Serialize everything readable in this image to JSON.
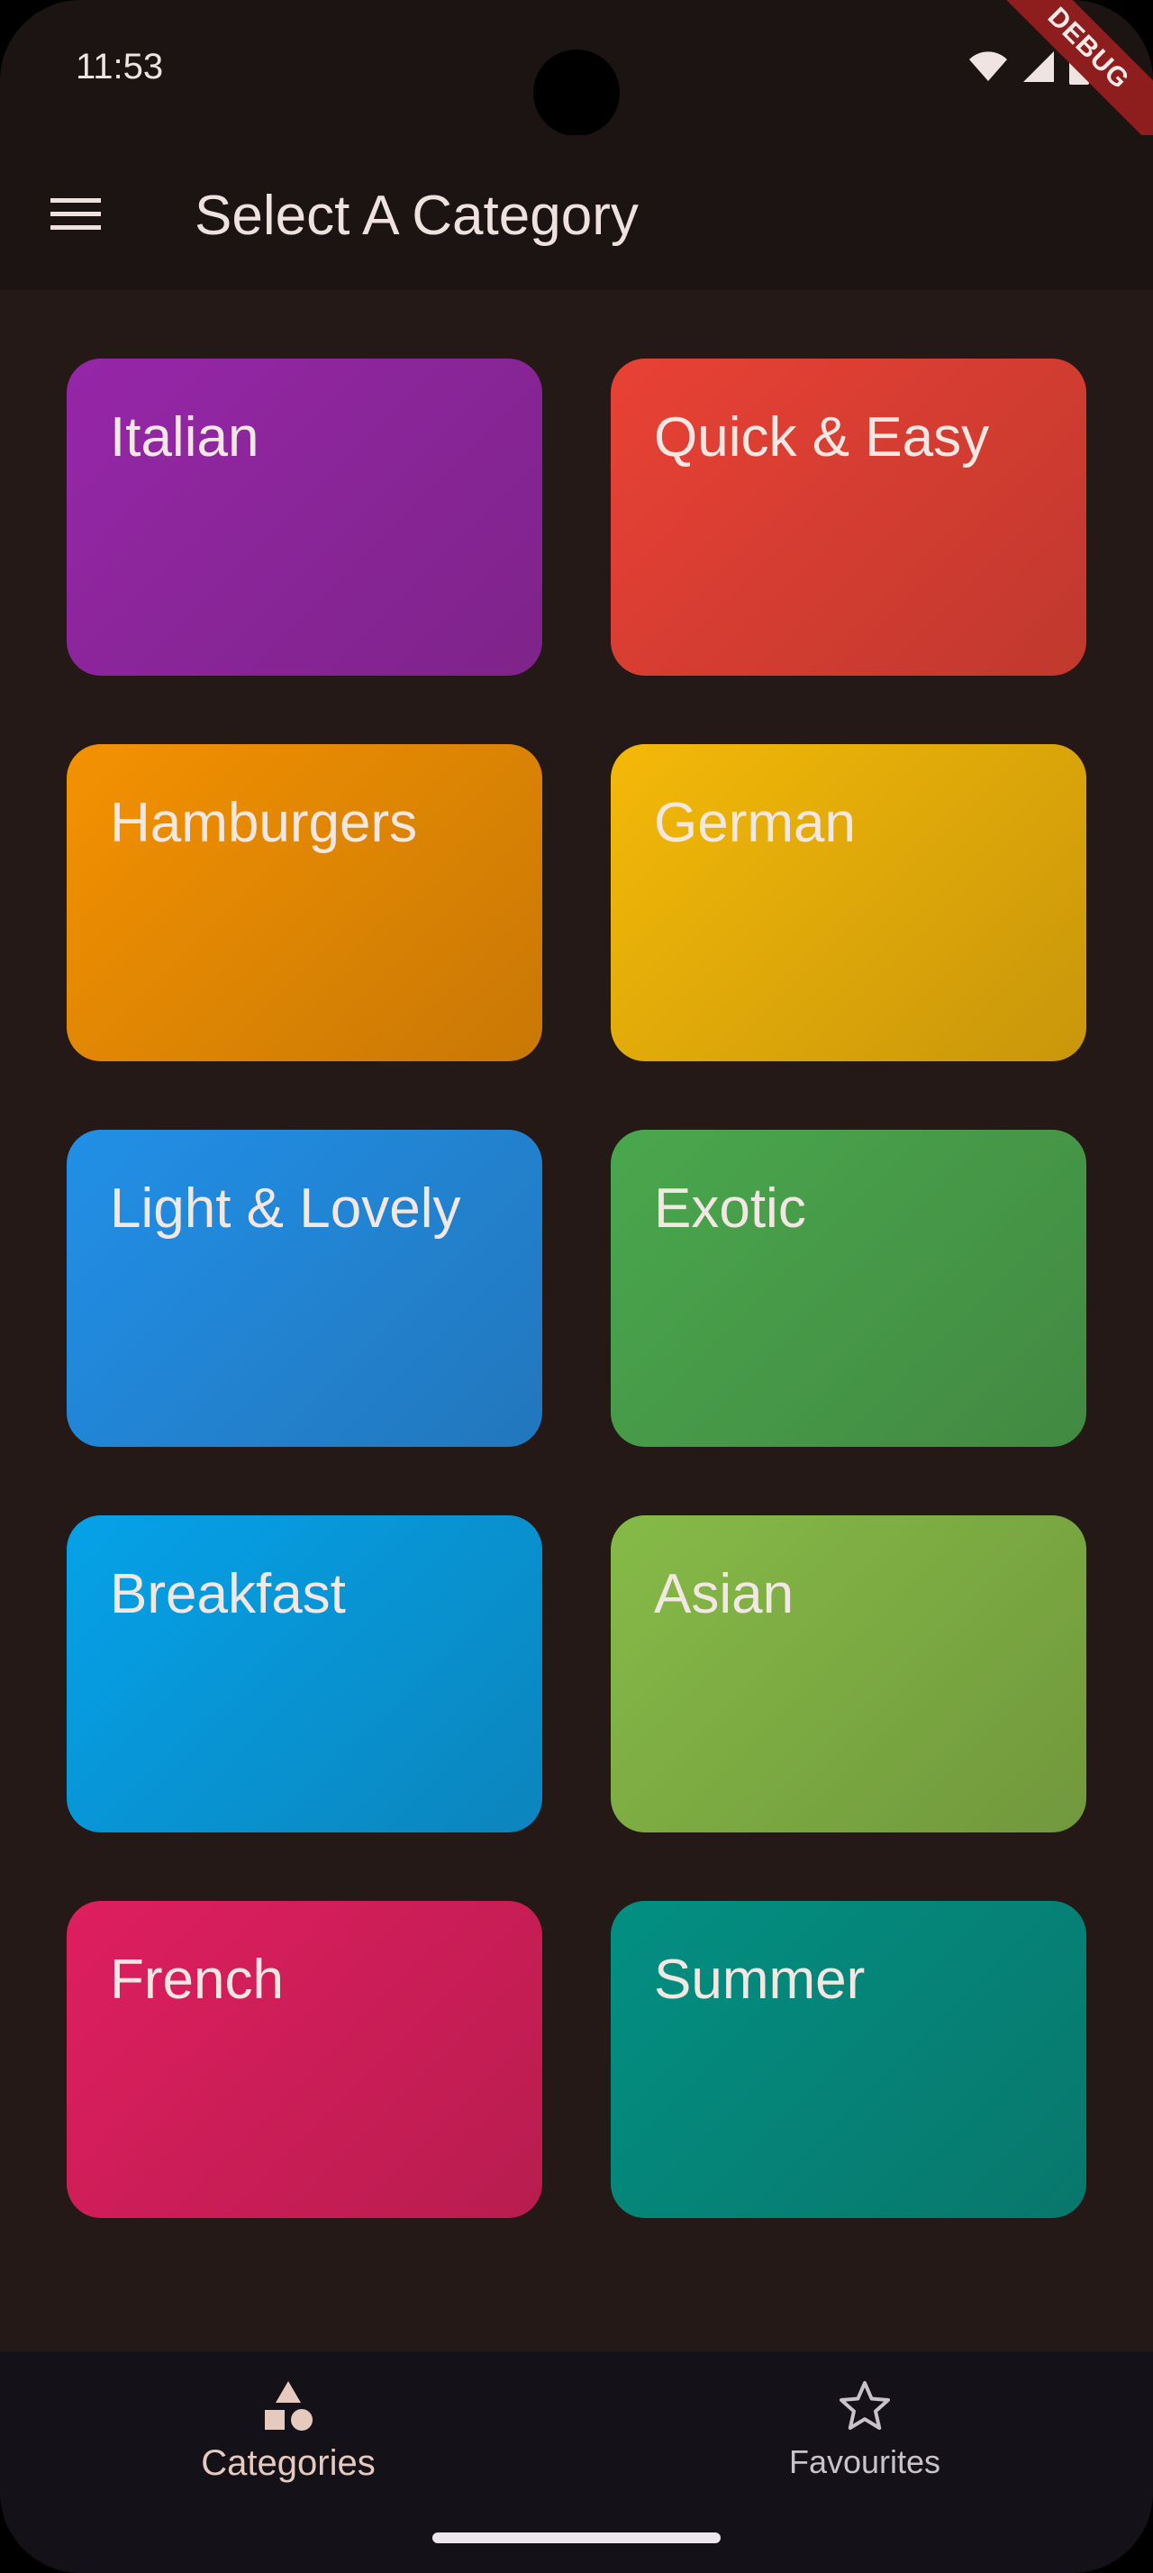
{
  "status_bar": {
    "time": "11:53",
    "debug_banner": "DEBUG"
  },
  "app_bar": {
    "title": "Select A Category",
    "menu_icon": "hamburger-menu-icon"
  },
  "categories": [
    {
      "label": "Italian",
      "color": "#9c27b0"
    },
    {
      "label": "Quick & Easy",
      "color": "#f44336"
    },
    {
      "label": "Hamburgers",
      "color": "#ff9800"
    },
    {
      "label": "German",
      "color": "#ffc107"
    },
    {
      "label": "Light & Lovely",
      "color": "#2196f3"
    },
    {
      "label": "Exotic",
      "color": "#4caf50"
    },
    {
      "label": "Breakfast",
      "color": "#03a9f4"
    },
    {
      "label": "Asian",
      "color": "#8bc34a"
    },
    {
      "label": "French",
      "color": "#e91e63"
    },
    {
      "label": "Summer",
      "color": "#009688"
    }
  ],
  "bottom_nav": {
    "items": [
      {
        "label": "Categories",
        "icon": "category-shapes-icon",
        "active": true
      },
      {
        "label": "Favourites",
        "icon": "star-outline-icon",
        "active": false
      }
    ]
  },
  "colors": {
    "background": "#241916",
    "app_bar": "#1b1412",
    "bottom_nav": "#141218",
    "text_primary": "#efe1dd",
    "nav_active": "#e6c9bf"
  }
}
